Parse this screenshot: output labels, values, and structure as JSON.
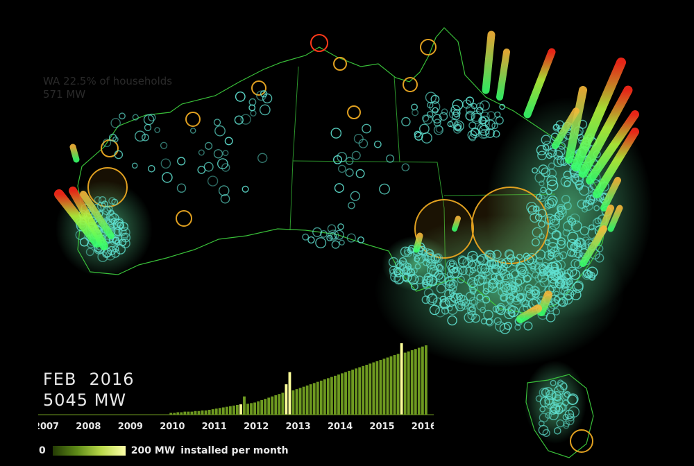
{
  "overlay": {
    "state_line": "WA 22.5% of households",
    "state_mw": "571 MW"
  },
  "current": {
    "month": "FEB",
    "year": "2016",
    "total": "5045 MW"
  },
  "legend": {
    "min_label": "0",
    "max_label": "200 MW",
    "caption": "installed per month",
    "gradient_colors": [
      "#243b05",
      "#5e8a18",
      "#b9d84a",
      "#fcffa8"
    ]
  },
  "colors": {
    "map_outline": "#3fd43f",
    "site_ring": "#5fe0d0",
    "large_site_ring": "#e0a020",
    "tall_column_top": "#ff2a1a",
    "column_base": "#3aff6a",
    "bar_default": "#6e9a20",
    "bar_highlight": "#fcff9a"
  },
  "chart_data": {
    "type": "bar",
    "title": "",
    "xlabel": "",
    "ylabel": "",
    "x_tick_labels": [
      "2007",
      "2008",
      "2009",
      "2010",
      "2011",
      "2012",
      "2013",
      "2014",
      "2015",
      "2016"
    ],
    "x_range": [
      "2007-01",
      "2016-02"
    ],
    "series": [
      {
        "values": [
          0,
          0,
          0,
          0,
          0,
          0,
          0,
          0,
          0,
          0,
          0,
          0,
          0,
          0,
          0,
          0,
          0,
          0,
          0,
          0,
          0,
          0,
          0,
          0,
          0,
          0,
          0,
          0,
          0,
          0,
          0,
          0,
          0,
          0,
          0,
          0,
          3,
          3,
          4,
          4,
          5,
          5,
          5,
          6,
          6,
          7,
          7,
          8,
          9,
          10,
          11,
          12,
          13,
          14,
          15,
          16,
          17,
          30,
          18,
          19,
          20,
          22,
          24,
          26,
          28,
          30,
          32,
          34,
          36,
          50,
          70,
          40,
          42,
          44,
          46,
          48,
          50,
          52,
          54,
          56,
          58,
          60,
          62,
          64,
          66,
          68,
          70,
          72,
          74,
          76,
          78,
          80,
          82,
          84,
          86,
          88,
          90,
          92,
          94,
          96,
          98,
          100,
          130,
          102,
          104,
          106,
          108,
          110,
          112,
          114
        ]
      }
    ],
    "highlight_months": [
      "2011-09",
      "2012-10",
      "2012-11",
      "2015-07"
    ]
  }
}
